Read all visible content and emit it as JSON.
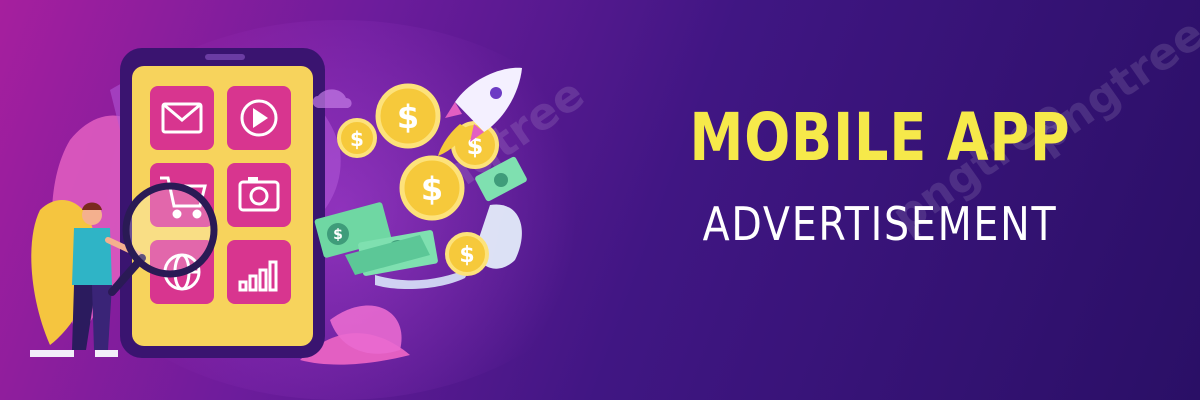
{
  "banner": {
    "title": "MOBILE APP",
    "subtitle": "ADVERTISEMENT",
    "watermark": "pngtree"
  },
  "colors": {
    "background_start": "#a61f9e",
    "background_end": "#2a0f66",
    "title": "#f6e94a",
    "subtitle": "#ffffff",
    "phone_screen": "#f7d35c",
    "app_tile": "#d8358f",
    "coin": "#f6c93b",
    "bill": "#6fd7a3"
  },
  "illustration": {
    "app_icons": [
      "mail-icon",
      "play-icon",
      "cart-icon",
      "camera-icon",
      "globe-icon",
      "signal-bars-icon"
    ],
    "currency_symbol": "$"
  }
}
